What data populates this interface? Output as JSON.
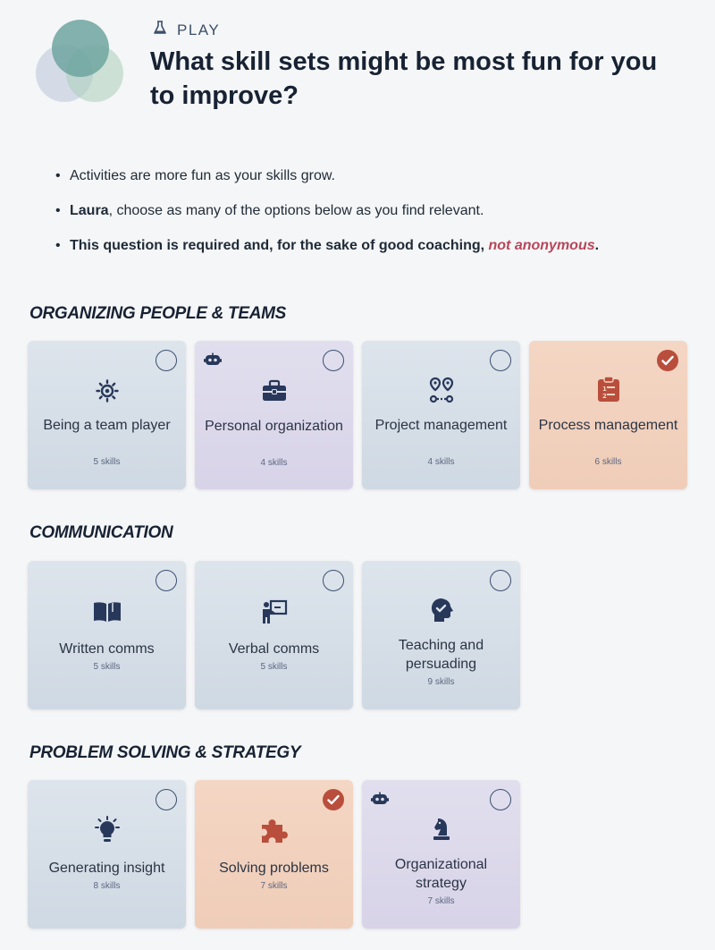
{
  "header": {
    "category_label": "PLAY",
    "title": "What skill sets might be most fun for you to improve?"
  },
  "intro": {
    "line1": "Activities are more fun as your skills grow.",
    "name": "Laura",
    "line2_rest": ", choose as many of the options below as you find relevant.",
    "line3_main": "This question is required and, for the sake of good coaching, ",
    "line3_emph": "not anonymous",
    "line3_end": "."
  },
  "sections": [
    {
      "title": "ORGANIZING PEOPLE & TEAMS",
      "cards": [
        {
          "label": "Being a team player",
          "count": "5 skills",
          "icon": "team-gear-icon",
          "checked": false,
          "theme": "blue",
          "robot": false
        },
        {
          "label": "Personal organization",
          "count": "4 skills",
          "icon": "briefcase-icon",
          "checked": false,
          "theme": "purple",
          "robot": true
        },
        {
          "label": "Project management",
          "count": "4 skills",
          "icon": "route-icon",
          "checked": false,
          "theme": "blue",
          "robot": false
        },
        {
          "label": "Process management",
          "count": "6 skills",
          "icon": "clipboard-list-icon",
          "checked": true,
          "theme": "orange",
          "robot": false
        }
      ]
    },
    {
      "title": "COMMUNICATION",
      "cards": [
        {
          "label": "Written comms",
          "count": "5 skills",
          "icon": "book-open-icon",
          "checked": false,
          "theme": "blue",
          "robot": false
        },
        {
          "label": "Verbal comms",
          "count": "5 skills",
          "icon": "presenter-icon",
          "checked": false,
          "theme": "blue",
          "robot": false
        },
        {
          "label": "Teaching and persuading",
          "count": "9 skills",
          "icon": "head-check-icon",
          "checked": false,
          "theme": "blue",
          "robot": false
        }
      ]
    },
    {
      "title": "PROBLEM SOLVING & STRATEGY",
      "cards": [
        {
          "label": "Generating insight",
          "count": "8 skills",
          "icon": "lightbulb-icon",
          "checked": false,
          "theme": "blue",
          "robot": false
        },
        {
          "label": "Solving problems",
          "count": "7 skills",
          "icon": "puzzle-icon",
          "checked": true,
          "theme": "orange",
          "robot": false
        },
        {
          "label": "Organizational strategy",
          "count": "7 skills",
          "icon": "chess-knight-icon",
          "checked": false,
          "theme": "purple",
          "robot": true
        }
      ]
    }
  ],
  "colors": {
    "accent_red": "#b8465a",
    "check_fill": "#b94e3c",
    "icon_navy": "#27385a"
  }
}
